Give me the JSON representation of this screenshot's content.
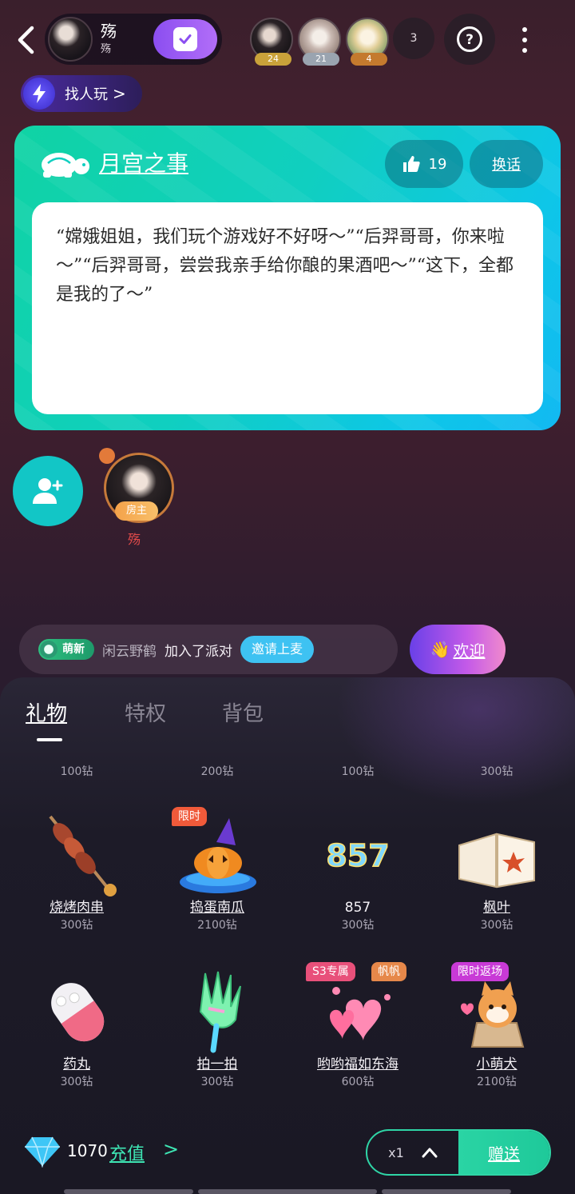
{
  "header": {
    "room_name": "殇",
    "room_sub": "殇",
    "rank": [
      {
        "badge": "24",
        "color": "#c9a23a"
      },
      {
        "badge": "21",
        "color": "#9aa4b0"
      },
      {
        "badge": "4",
        "color": "#c47a2e"
      }
    ],
    "viewer_count": "3",
    "help_glyph": "?",
    "find_label": "找人玩",
    "find_arrow": ">"
  },
  "topic": {
    "title": "月宫之事",
    "likes": "19",
    "switch_label": "换话",
    "text": "“嫦娥姐姐，我们玩个游戏好不好呀～”“后羿哥哥，你来啦～”“后羿哥哥，尝尝我亲手给你酿的果酒吧～”“这下，全都是我的了～”"
  },
  "seats": {
    "host_tag": "房主",
    "host_name": "殇"
  },
  "chat": {
    "level_badge": "萌新",
    "user": "闲云野鹤",
    "message": "加入了派对",
    "invite_label": "邀请上麦",
    "welcome_label": "欢迎",
    "welcome_emoji": "👋"
  },
  "gift_panel": {
    "tabs": [
      "礼物",
      "特权",
      "背包"
    ],
    "partial_row": [
      {
        "price": "100钻"
      },
      {
        "price": "200钻"
      },
      {
        "price": "100钻"
      },
      {
        "price": "300钻"
      }
    ],
    "rows": [
      [
        {
          "name": "烧烤肉串",
          "price": "300钻",
          "tags": [],
          "icon": "kebab-icon"
        },
        {
          "name": "捣蛋南瓜",
          "price": "2100钻",
          "tags": [
            "限时"
          ],
          "icon": "pumpkin-icon"
        },
        {
          "name": "857",
          "price": "300钻",
          "tags": [],
          "icon": "neon-857-icon",
          "art_text": "857"
        },
        {
          "name": "枫叶",
          "price": "300钻",
          "tags": [],
          "icon": "maple-book-icon"
        }
      ],
      [
        {
          "name": "药丸",
          "price": "300钻",
          "tags": [],
          "icon": "pill-icon"
        },
        {
          "name": "拍一拍",
          "price": "300钻",
          "tags": [],
          "icon": "clapper-hand-icon"
        },
        {
          "name": "哟哟福如东海",
          "price": "600钻",
          "tags": [
            "S3专属",
            "帆帆"
          ],
          "icon": "hearts-icon"
        },
        {
          "name": "小萌犬",
          "price": "2100钻",
          "tags": [
            "限时返场"
          ],
          "icon": "shiba-dog-icon"
        }
      ]
    ]
  },
  "footer": {
    "balance": "1070",
    "recharge_label": "充值",
    "recharge_arrow": ">",
    "qty_label": "x1",
    "send_label": "赠送"
  },
  "colors": {
    "accent_green": "#2fd5a6",
    "topic_teal": "#10d3a4",
    "topic_blue": "#12b9f2",
    "checkin_purple": "#8b4ef0",
    "limited_tag": "#f05a3a",
    "s3_tag": "#e8507a",
    "fanfan_tag": "#e6884a",
    "return_tag": "#c83ad6"
  }
}
